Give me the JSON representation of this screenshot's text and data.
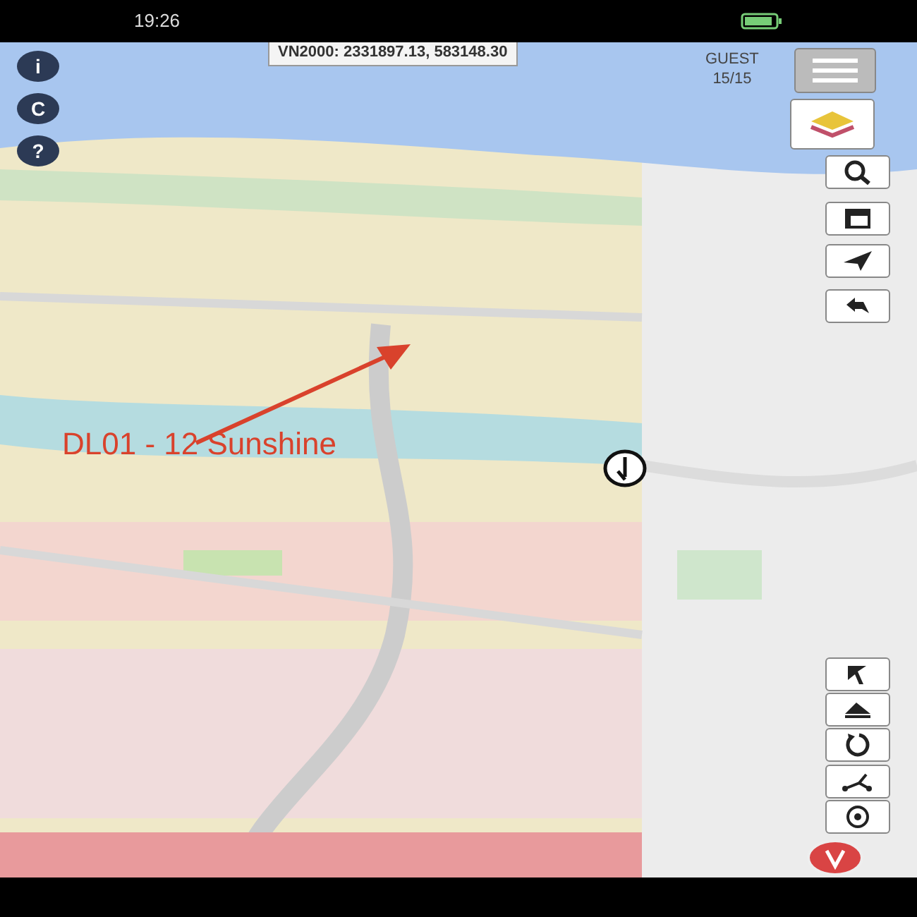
{
  "status_bar": {
    "time": "19:26"
  },
  "coordinates": "VN2000: 2331897.13, 583148.30",
  "user": {
    "name": "GUEST",
    "count": "15/15"
  },
  "left_buttons": [
    {
      "label": "i"
    },
    {
      "label": "C"
    },
    {
      "label": "?"
    }
  ],
  "annotation": {
    "label": "DL01 - 12 Sunshine",
    "color": "#d9422c"
  }
}
